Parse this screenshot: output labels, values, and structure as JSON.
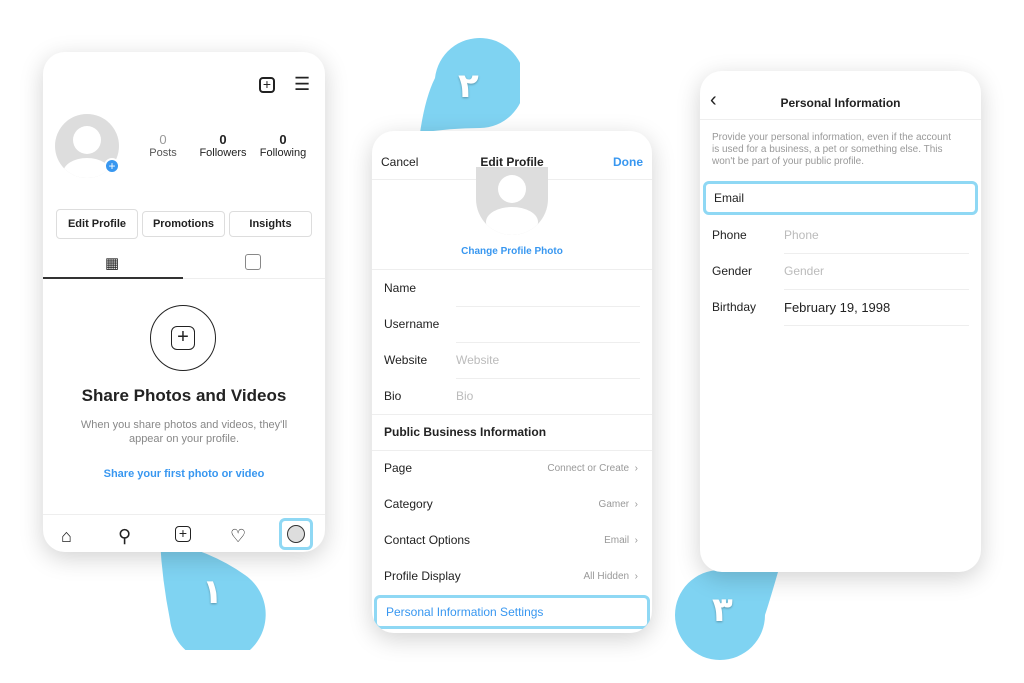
{
  "accent": "#3897f0",
  "highlight": "#8fd8f4",
  "steps": [
    "١",
    "٢",
    "٣"
  ],
  "screen1": {
    "stats": [
      {
        "value": "0",
        "label": "Posts"
      },
      {
        "value": "0",
        "label": "Followers"
      },
      {
        "value": "0",
        "label": "Following"
      }
    ],
    "buttons": [
      "Edit Profile",
      "Promotions",
      "Insights"
    ],
    "empty_title": "Share Photos and Videos",
    "empty_text": "When you share photos and videos, they'll appear on your profile.",
    "empty_link": "Share your first photo or video",
    "nav_icons": [
      "home-icon",
      "search-icon",
      "add-icon",
      "heart-icon",
      "profile-icon"
    ]
  },
  "screen2": {
    "cancel": "Cancel",
    "title": "Edit Profile",
    "done": "Done",
    "change_photo": "Change Profile Photo",
    "fields": [
      {
        "label": "Name",
        "placeholder": ""
      },
      {
        "label": "Username",
        "placeholder": ""
      },
      {
        "label": "Website",
        "placeholder": "Website"
      },
      {
        "label": "Bio",
        "placeholder": "Bio"
      }
    ],
    "section": "Public Business Information",
    "business": [
      {
        "label": "Page",
        "value": "Connect or Create"
      },
      {
        "label": "Category",
        "value": "Gamer"
      },
      {
        "label": "Contact Options",
        "value": "Email"
      },
      {
        "label": "Profile Display",
        "value": "All Hidden"
      }
    ],
    "personal_link": "Personal Information Settings"
  },
  "screen3": {
    "title": "Personal Information",
    "description": "Provide your personal information, even if the account is used for a business, a pet or something else. This won't be part of your public profile.",
    "fields": [
      {
        "label": "Email",
        "value": ""
      },
      {
        "label": "Phone",
        "placeholder": "Phone"
      },
      {
        "label": "Gender",
        "placeholder": "Gender"
      },
      {
        "label": "Birthday",
        "value": "February 19, 1998"
      }
    ]
  }
}
